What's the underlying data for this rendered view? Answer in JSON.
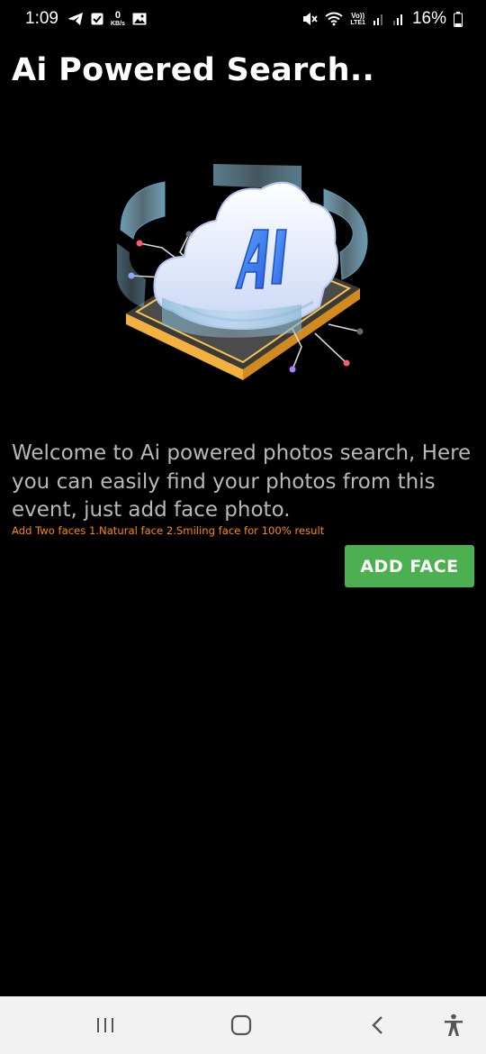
{
  "status_bar": {
    "time": "1:09",
    "net_speed_value": "0",
    "net_speed_unit": "KB/s",
    "volte_top": "Vo))",
    "volte_bottom": "LTE1",
    "battery_percent": "16%",
    "icons": [
      "telegram-icon",
      "checkbox-notification-icon",
      "image-notification-icon",
      "mute-icon",
      "wifi-icon",
      "signal-icon",
      "signal-icon-2",
      "battery-icon"
    ]
  },
  "header": {
    "title": "Ai Powered Search.."
  },
  "hero": {
    "icon": "ai-cloud-illustration",
    "label": "AI"
  },
  "main": {
    "welcome": "Welcome to Ai powered photos search, Here you can easily find your photos from this event, just add face photo.",
    "hint": "Add Two faces 1.Natural face 2.Smiling face for 100% result",
    "add_face_label": "ADD FACE"
  },
  "colors": {
    "background": "#000000",
    "accent_button": "#4caf50",
    "hint_text": "#ff8a00",
    "body_text": "#b8b8b8"
  },
  "nav_bar": {
    "icons": [
      "recents-icon",
      "home-icon",
      "back-icon",
      "accessibility-icon"
    ]
  }
}
